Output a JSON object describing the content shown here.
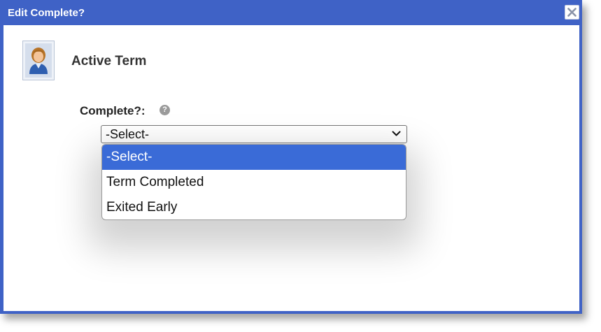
{
  "dialog": {
    "title": "Edit Complete?",
    "close_icon": "close-icon",
    "accent_color": "#3f62c6"
  },
  "header": {
    "avatar_icon": "user-avatar-icon",
    "term_title": "Active Term"
  },
  "form": {
    "complete_label": "Complete?:",
    "help_icon": "help-icon",
    "help_glyph": "?",
    "select_value": "-Select-",
    "options": [
      {
        "label": "-Select-",
        "selected": true
      },
      {
        "label": "Term Completed",
        "selected": false
      },
      {
        "label": "Exited Early",
        "selected": false
      }
    ],
    "highlight_color": "#3a6bd7"
  }
}
